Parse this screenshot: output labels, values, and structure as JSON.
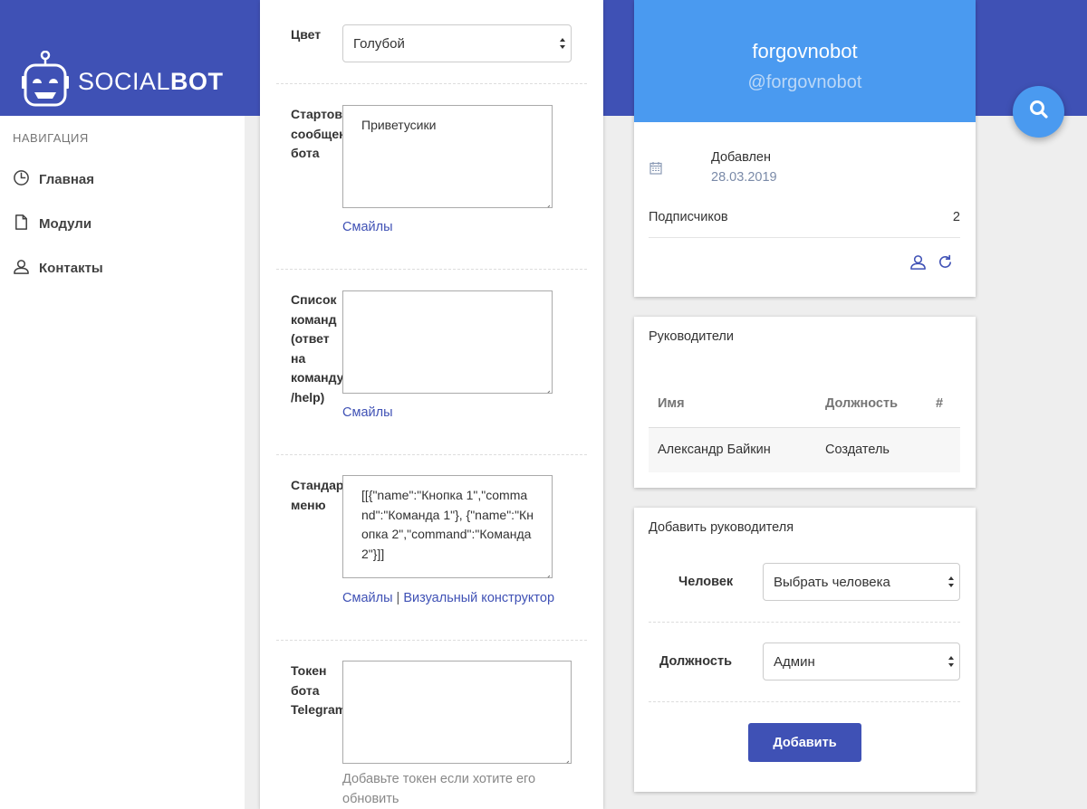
{
  "brand": {
    "name_light": "SOCIAL",
    "name_bold": "BOT"
  },
  "colors": {
    "primary": "#3f51b5",
    "accent": "#4a9af0",
    "link": "#3f51b5"
  },
  "nav": {
    "heading": "НАВИГАЦИЯ",
    "items": [
      {
        "label": "Главная",
        "icon": "clock-icon"
      },
      {
        "label": "Модули",
        "icon": "document-icon"
      },
      {
        "label": "Контакты",
        "icon": "user-icon"
      }
    ]
  },
  "form": {
    "color": {
      "label": "Цвет",
      "value": "Голубой"
    },
    "start_message": {
      "label": "Стартовое сообщение бота",
      "value": "Приветусики",
      "links": [
        "Смайлы"
      ]
    },
    "commands": {
      "label": "Список команд (ответ на команду /help)",
      "value": "",
      "links": [
        "Смайлы"
      ]
    },
    "menu": {
      "label": "Стандартное меню",
      "value": "[[{\"name\":\"Кнопка 1\",\"command\":\"Команда 1\"}, {\"name\":\"Кнопка 2\",\"command\":\"Команда 2\"}]]",
      "links": [
        "Смайлы",
        "Визуальный конструктор"
      ],
      "separator": "|"
    },
    "token": {
      "label": "Токен бота Telegram",
      "value": "",
      "hint": "Добавьте токен если хотите его обновить"
    }
  },
  "profile": {
    "name": "forgovnobot",
    "handle": "@forgovnobot",
    "added_label": "Добавлен",
    "added_date": "28.03.2019",
    "subscribers_label": "Подписчиков",
    "subscribers_count": "2"
  },
  "managers": {
    "title": "Руководители",
    "columns": [
      "Имя",
      "Должность",
      "#"
    ],
    "rows": [
      {
        "name": "Александр Байкин",
        "role": "Создатель",
        "action": ""
      }
    ]
  },
  "add_manager": {
    "title": "Добавить руководителя",
    "person_label": "Человек",
    "person_value": "Выбрать человека",
    "role_label": "Должность",
    "role_value": "Админ",
    "submit_label": "Добавить"
  }
}
